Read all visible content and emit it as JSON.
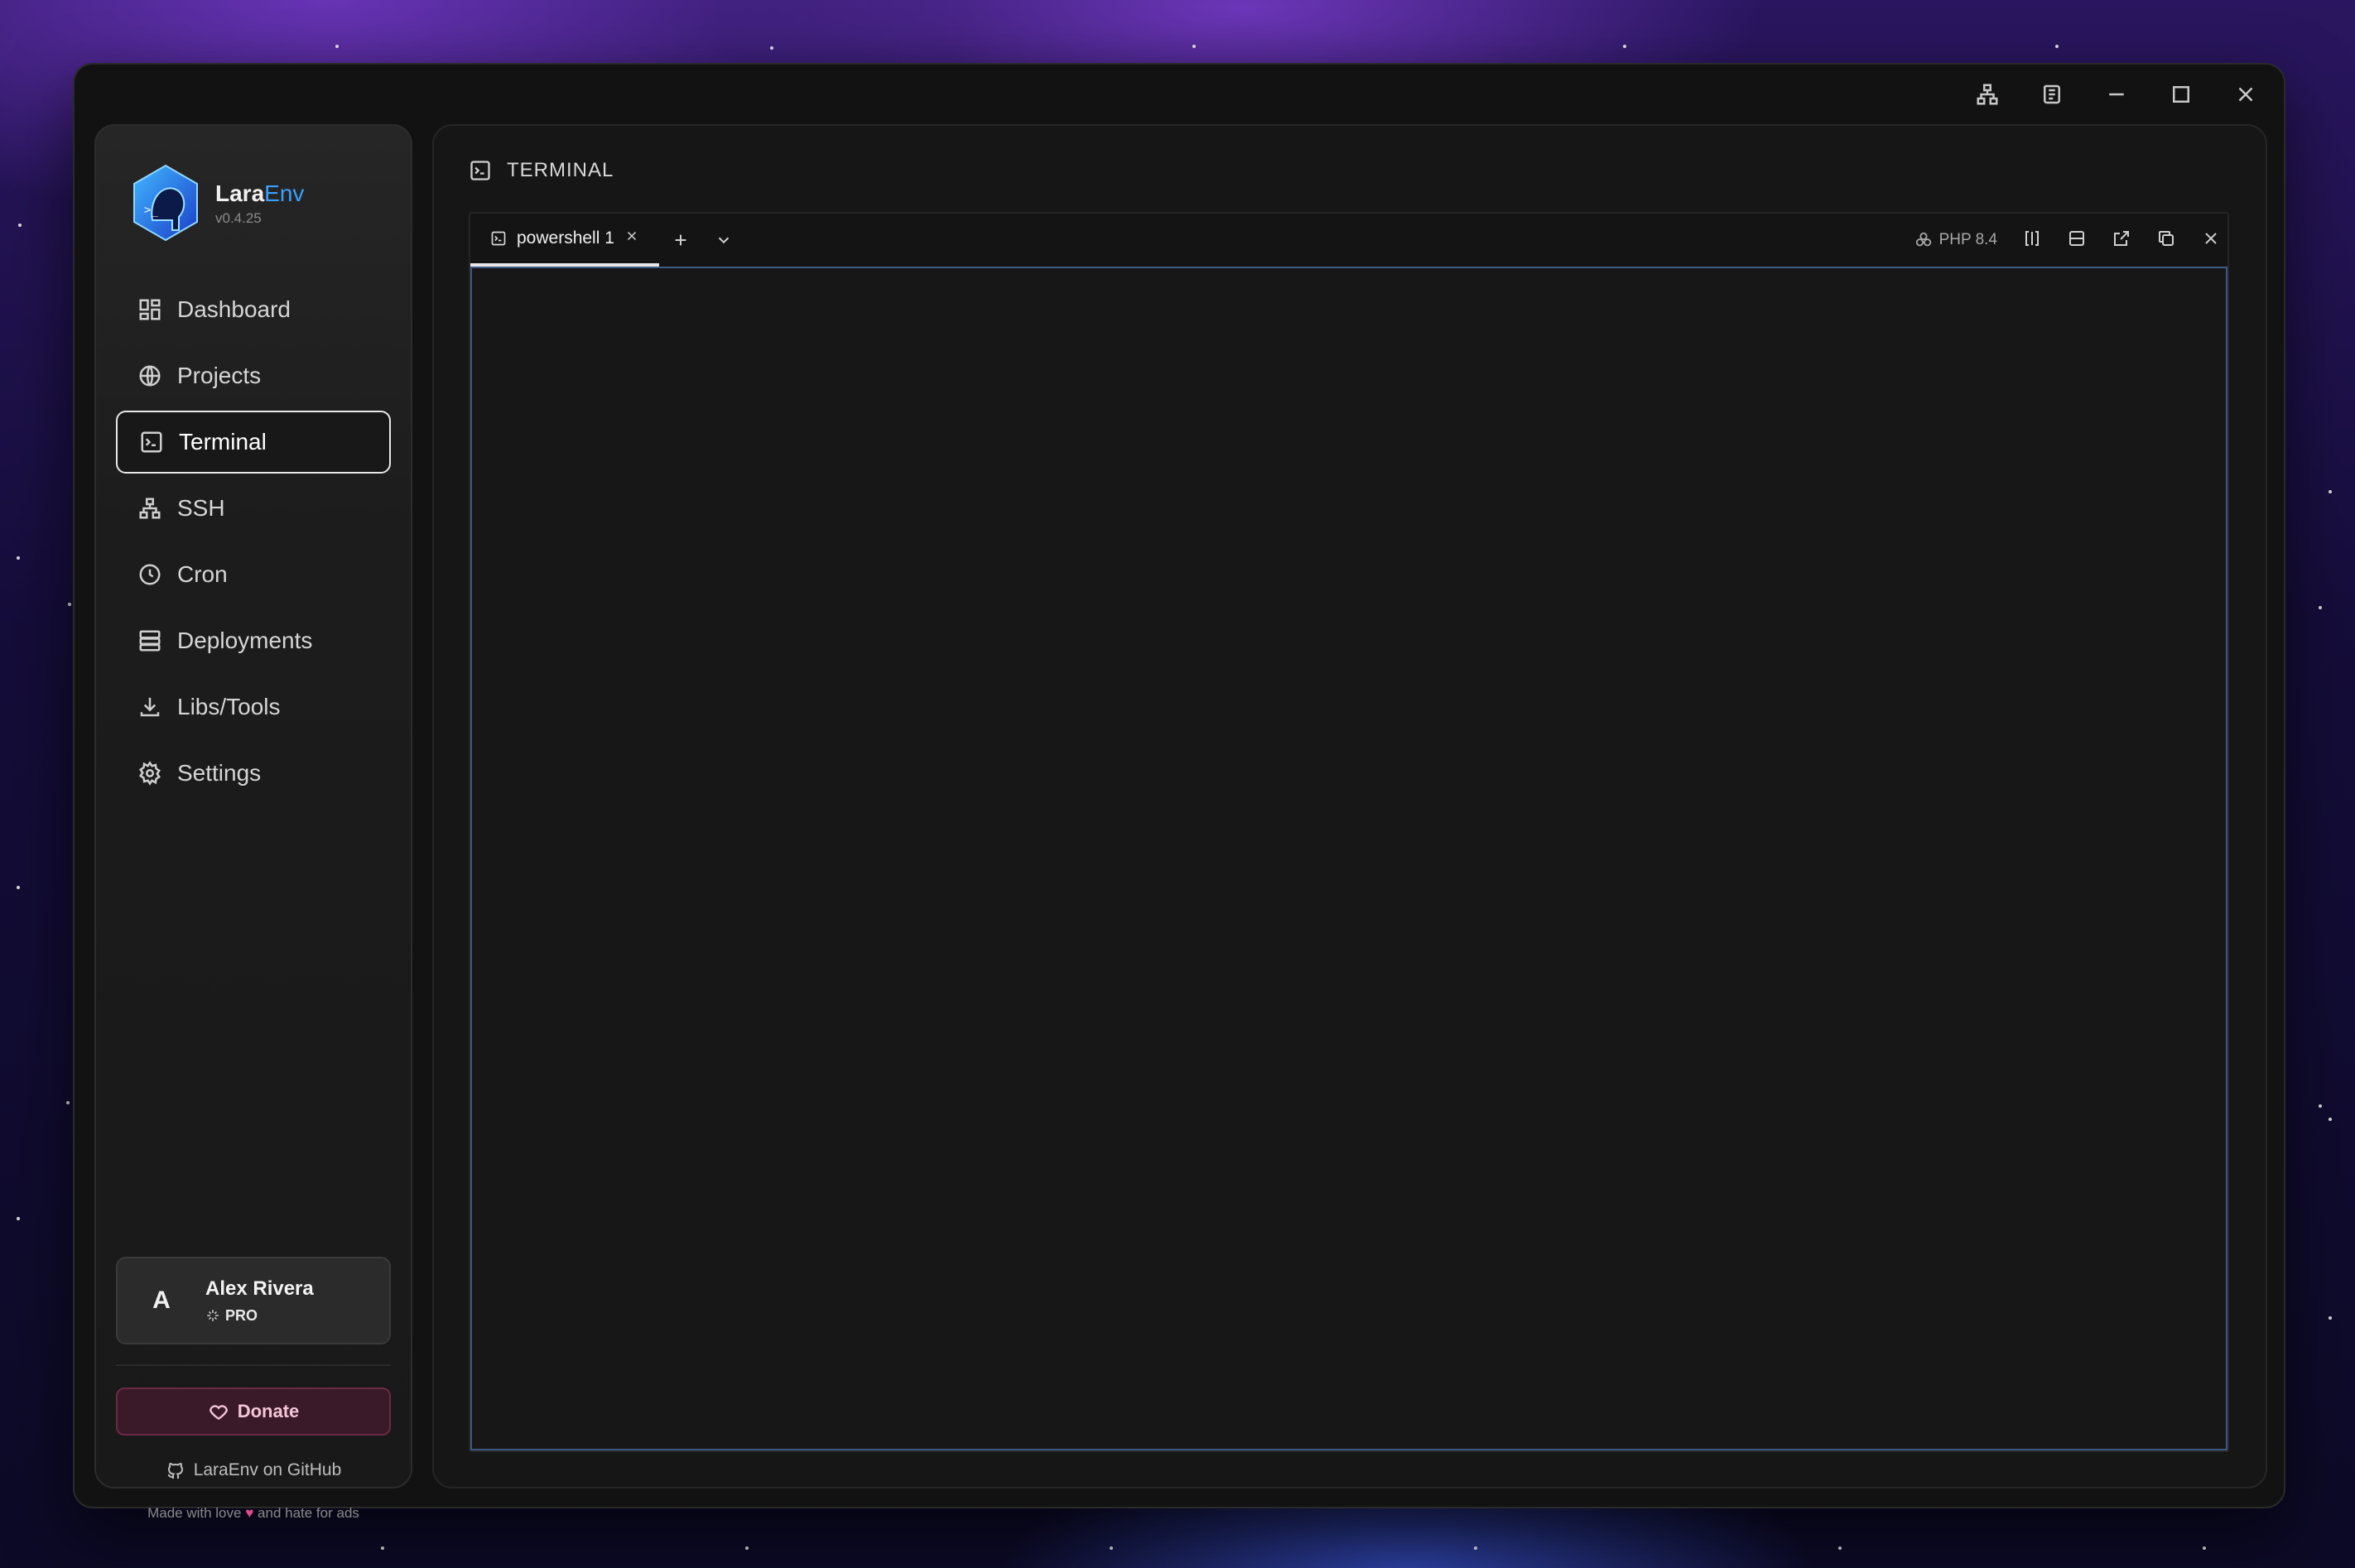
{
  "app": {
    "name_main": "Lara",
    "name_accent": "Env",
    "version": "v0.4.25"
  },
  "titlebar": {
    "icons": [
      "network-icon",
      "log-icon",
      "minimize-icon",
      "maximize-icon",
      "close-icon"
    ]
  },
  "sidebar": {
    "items": [
      {
        "label": "Dashboard",
        "icon": "dashboard-icon"
      },
      {
        "label": "Projects",
        "icon": "globe-icon"
      },
      {
        "label": "Terminal",
        "icon": "terminal-icon",
        "active": true
      },
      {
        "label": "SSH",
        "icon": "network-icon"
      },
      {
        "label": "Cron",
        "icon": "clock-icon"
      },
      {
        "label": "Deployments",
        "icon": "server-icon"
      },
      {
        "label": "Libs/Tools",
        "icon": "download-icon"
      },
      {
        "label": "Settings",
        "icon": "gear-icon"
      }
    ],
    "user": {
      "initial": "A",
      "name": "Alex Rivera",
      "plan": "PRO"
    },
    "donate_label": "Donate",
    "github_label": "LaraEnv on GitHub",
    "footer": {
      "before": "Made with love",
      "after": "and hate for ads"
    }
  },
  "main": {
    "header": "TERMINAL",
    "tabs": [
      {
        "label": "powershell 1",
        "active": true
      }
    ],
    "php_version": "PHP 8.4"
  },
  "colors": {
    "accent": "#3aa0ff",
    "terminal_border": "#3b5a86",
    "donate": "#f3c6d8"
  }
}
